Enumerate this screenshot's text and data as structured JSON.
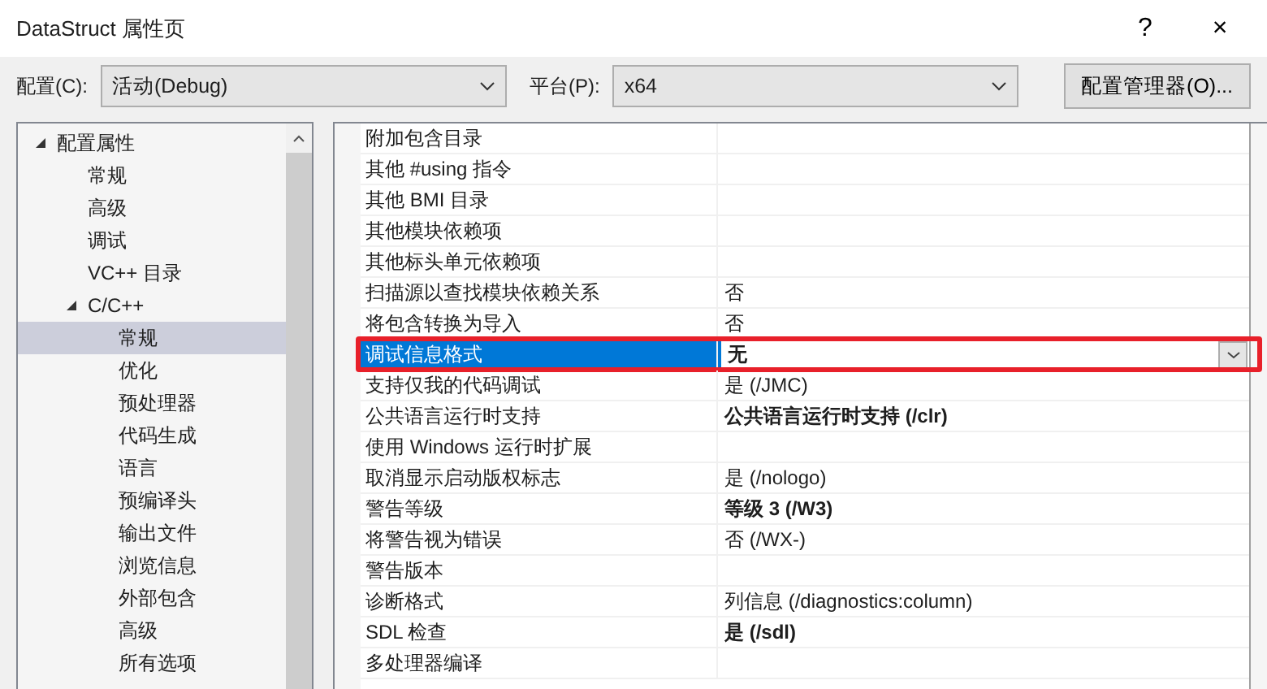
{
  "window": {
    "title": "DataStruct 属性页",
    "help": "?",
    "close": "×"
  },
  "toolbar": {
    "config_label": "配置(C):",
    "config_value": "活动(Debug)",
    "platform_label": "平台(P):",
    "platform_value": "x64",
    "manager_button": "配置管理器(O)..."
  },
  "tree": [
    {
      "label": "配置属性",
      "expanded": true,
      "selected": false,
      "children": [
        {
          "label": "常规",
          "selected": false
        },
        {
          "label": "高级",
          "selected": false
        },
        {
          "label": "调试",
          "selected": false
        },
        {
          "label": "VC++ 目录",
          "selected": false
        },
        {
          "label": "C/C++",
          "expanded": true,
          "selected": false,
          "children": [
            {
              "label": "常规",
              "selected": true
            },
            {
              "label": "优化",
              "selected": false
            },
            {
              "label": "预处理器",
              "selected": false
            },
            {
              "label": "代码生成",
              "selected": false
            },
            {
              "label": "语言",
              "selected": false
            },
            {
              "label": "预编译头",
              "selected": false
            },
            {
              "label": "输出文件",
              "selected": false
            },
            {
              "label": "浏览信息",
              "selected": false
            },
            {
              "label": "外部包含",
              "selected": false
            },
            {
              "label": "高级",
              "selected": false
            },
            {
              "label": "所有选项",
              "selected": false
            }
          ]
        }
      ]
    }
  ],
  "properties": [
    {
      "name": "附加包含目录",
      "selected": false
    },
    {
      "name": "其他 #using 指令",
      "selected": false
    },
    {
      "name": "其他 BMI 目录",
      "selected": false
    },
    {
      "name": "其他模块依赖项",
      "selected": false
    },
    {
      "name": "其他标头单元依赖项",
      "selected": false
    },
    {
      "name": "扫描源以查找模块依赖关系",
      "value": "否",
      "selected": false
    },
    {
      "name": "将包含转换为导入",
      "value": "否",
      "selected": false
    },
    {
      "name": "调试信息格式",
      "value": "无",
      "bold": true,
      "selected": true,
      "annotated": true
    },
    {
      "name": "支持仅我的代码调试",
      "value": "是 (/JMC)",
      "selected": false
    },
    {
      "name": "公共语言运行时支持",
      "value": "公共语言运行时支持 (/clr)",
      "bold": true,
      "selected": false
    },
    {
      "name": "使用 Windows 运行时扩展",
      "selected": false
    },
    {
      "name": "取消显示启动版权标志",
      "value": "是 (/nologo)",
      "selected": false
    },
    {
      "name": "警告等级",
      "value": "等级 3 (/W3)",
      "bold": true,
      "selected": false
    },
    {
      "name": "将警告视为错误",
      "value": "否 (/WX-)",
      "selected": false
    },
    {
      "name": "警告版本",
      "selected": false
    },
    {
      "name": "诊断格式",
      "value": "列信息 (/diagnostics:column)",
      "selected": false
    },
    {
      "name": "SDL 检查",
      "value": "是 (/sdl)",
      "bold": true,
      "selected": false
    },
    {
      "name": "多处理器编译",
      "selected": false
    }
  ]
}
